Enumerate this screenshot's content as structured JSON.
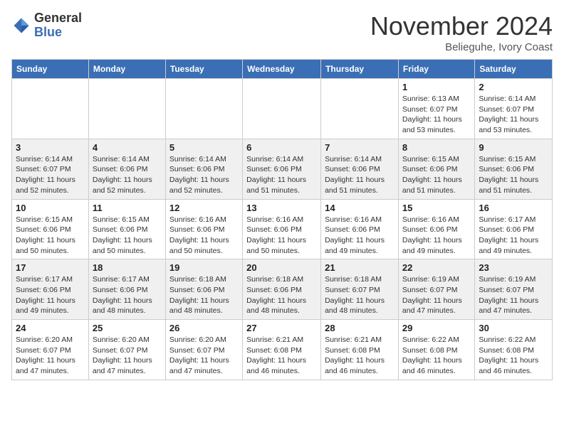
{
  "header": {
    "logo_line1": "General",
    "logo_line2": "Blue",
    "month": "November 2024",
    "location": "Belieguhe, Ivory Coast"
  },
  "weekdays": [
    "Sunday",
    "Monday",
    "Tuesday",
    "Wednesday",
    "Thursday",
    "Friday",
    "Saturday"
  ],
  "weeks": [
    [
      {
        "day": "",
        "detail": ""
      },
      {
        "day": "",
        "detail": ""
      },
      {
        "day": "",
        "detail": ""
      },
      {
        "day": "",
        "detail": ""
      },
      {
        "day": "",
        "detail": ""
      },
      {
        "day": "1",
        "detail": "Sunrise: 6:13 AM\nSunset: 6:07 PM\nDaylight: 11 hours and 53 minutes."
      },
      {
        "day": "2",
        "detail": "Sunrise: 6:14 AM\nSunset: 6:07 PM\nDaylight: 11 hours and 53 minutes."
      }
    ],
    [
      {
        "day": "3",
        "detail": "Sunrise: 6:14 AM\nSunset: 6:07 PM\nDaylight: 11 hours and 52 minutes."
      },
      {
        "day": "4",
        "detail": "Sunrise: 6:14 AM\nSunset: 6:06 PM\nDaylight: 11 hours and 52 minutes."
      },
      {
        "day": "5",
        "detail": "Sunrise: 6:14 AM\nSunset: 6:06 PM\nDaylight: 11 hours and 52 minutes."
      },
      {
        "day": "6",
        "detail": "Sunrise: 6:14 AM\nSunset: 6:06 PM\nDaylight: 11 hours and 51 minutes."
      },
      {
        "day": "7",
        "detail": "Sunrise: 6:14 AM\nSunset: 6:06 PM\nDaylight: 11 hours and 51 minutes."
      },
      {
        "day": "8",
        "detail": "Sunrise: 6:15 AM\nSunset: 6:06 PM\nDaylight: 11 hours and 51 minutes."
      },
      {
        "day": "9",
        "detail": "Sunrise: 6:15 AM\nSunset: 6:06 PM\nDaylight: 11 hours and 51 minutes."
      }
    ],
    [
      {
        "day": "10",
        "detail": "Sunrise: 6:15 AM\nSunset: 6:06 PM\nDaylight: 11 hours and 50 minutes."
      },
      {
        "day": "11",
        "detail": "Sunrise: 6:15 AM\nSunset: 6:06 PM\nDaylight: 11 hours and 50 minutes."
      },
      {
        "day": "12",
        "detail": "Sunrise: 6:16 AM\nSunset: 6:06 PM\nDaylight: 11 hours and 50 minutes."
      },
      {
        "day": "13",
        "detail": "Sunrise: 6:16 AM\nSunset: 6:06 PM\nDaylight: 11 hours and 50 minutes."
      },
      {
        "day": "14",
        "detail": "Sunrise: 6:16 AM\nSunset: 6:06 PM\nDaylight: 11 hours and 49 minutes."
      },
      {
        "day": "15",
        "detail": "Sunrise: 6:16 AM\nSunset: 6:06 PM\nDaylight: 11 hours and 49 minutes."
      },
      {
        "day": "16",
        "detail": "Sunrise: 6:17 AM\nSunset: 6:06 PM\nDaylight: 11 hours and 49 minutes."
      }
    ],
    [
      {
        "day": "17",
        "detail": "Sunrise: 6:17 AM\nSunset: 6:06 PM\nDaylight: 11 hours and 49 minutes."
      },
      {
        "day": "18",
        "detail": "Sunrise: 6:17 AM\nSunset: 6:06 PM\nDaylight: 11 hours and 48 minutes."
      },
      {
        "day": "19",
        "detail": "Sunrise: 6:18 AM\nSunset: 6:06 PM\nDaylight: 11 hours and 48 minutes."
      },
      {
        "day": "20",
        "detail": "Sunrise: 6:18 AM\nSunset: 6:06 PM\nDaylight: 11 hours and 48 minutes."
      },
      {
        "day": "21",
        "detail": "Sunrise: 6:18 AM\nSunset: 6:07 PM\nDaylight: 11 hours and 48 minutes."
      },
      {
        "day": "22",
        "detail": "Sunrise: 6:19 AM\nSunset: 6:07 PM\nDaylight: 11 hours and 47 minutes."
      },
      {
        "day": "23",
        "detail": "Sunrise: 6:19 AM\nSunset: 6:07 PM\nDaylight: 11 hours and 47 minutes."
      }
    ],
    [
      {
        "day": "24",
        "detail": "Sunrise: 6:20 AM\nSunset: 6:07 PM\nDaylight: 11 hours and 47 minutes."
      },
      {
        "day": "25",
        "detail": "Sunrise: 6:20 AM\nSunset: 6:07 PM\nDaylight: 11 hours and 47 minutes."
      },
      {
        "day": "26",
        "detail": "Sunrise: 6:20 AM\nSunset: 6:07 PM\nDaylight: 11 hours and 47 minutes."
      },
      {
        "day": "27",
        "detail": "Sunrise: 6:21 AM\nSunset: 6:08 PM\nDaylight: 11 hours and 46 minutes."
      },
      {
        "day": "28",
        "detail": "Sunrise: 6:21 AM\nSunset: 6:08 PM\nDaylight: 11 hours and 46 minutes."
      },
      {
        "day": "29",
        "detail": "Sunrise: 6:22 AM\nSunset: 6:08 PM\nDaylight: 11 hours and 46 minutes."
      },
      {
        "day": "30",
        "detail": "Sunrise: 6:22 AM\nSunset: 6:08 PM\nDaylight: 11 hours and 46 minutes."
      }
    ]
  ]
}
